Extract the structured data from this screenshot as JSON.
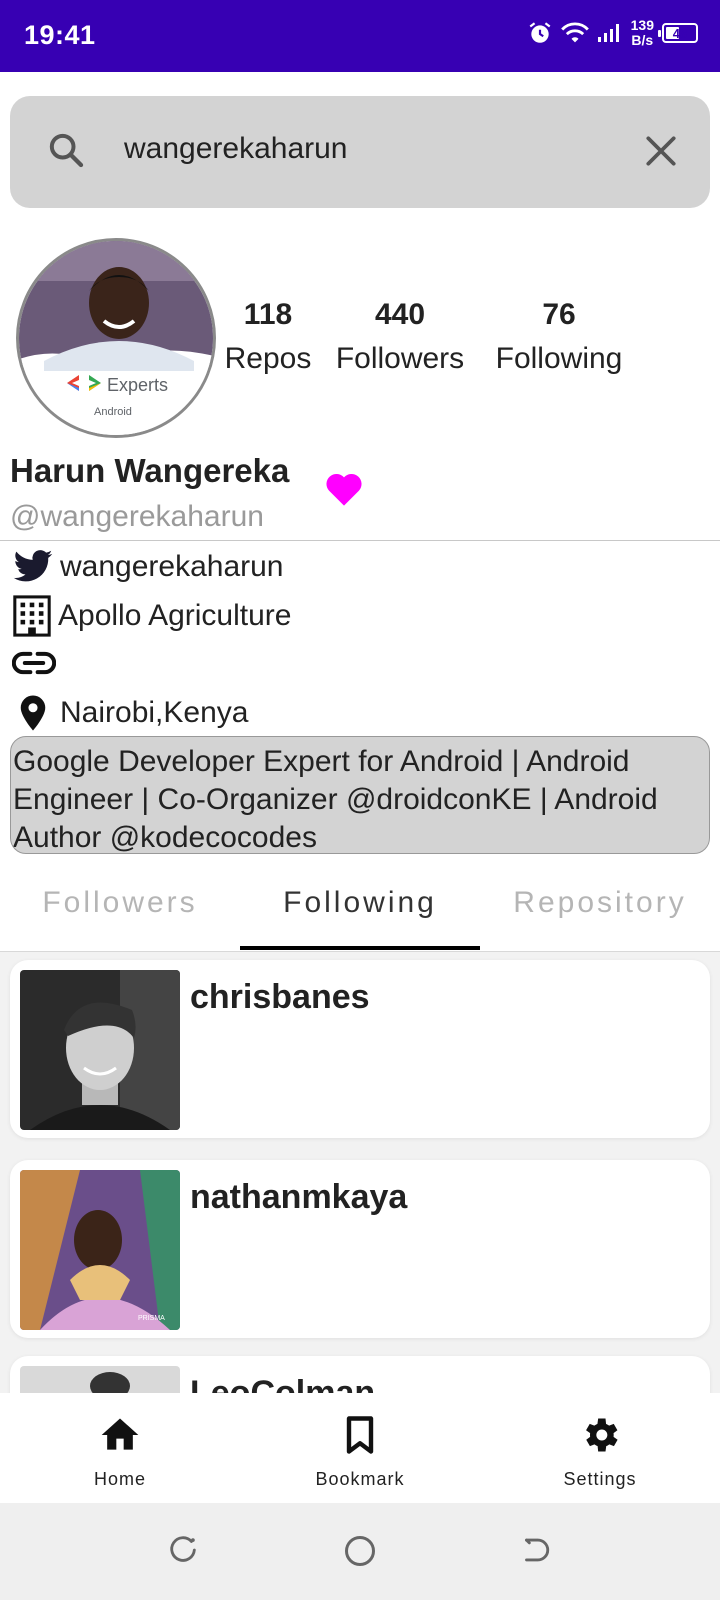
{
  "status_bar": {
    "time": "19:41",
    "net_speed_value": "139",
    "net_speed_unit": "B/s",
    "battery": "48",
    "battery_fraction": 0.48
  },
  "search": {
    "query": "wangerekaharun"
  },
  "profile": {
    "avatar_badge": "Experts",
    "avatar_badge_sub": "Android",
    "stats": {
      "repos": {
        "value": "118",
        "label": "Repos"
      },
      "followers": {
        "value": "440",
        "label": "Followers"
      },
      "following": {
        "value": "76",
        "label": "Following"
      }
    },
    "name": "Harun Wangereka",
    "handle": "@wangerekaharun",
    "twitter": "wangerekaharun",
    "company": "Apollo Agriculture",
    "link": "",
    "location": "Nairobi,Kenya",
    "bio": "Google Developer Expert for Android | Android Engineer | Co-Organizer @droidconKE  | Android Author @kodecocodes"
  },
  "tabs": [
    {
      "label": "Followers",
      "active": false
    },
    {
      "label": "Following",
      "active": true
    },
    {
      "label": "Repository",
      "active": false
    }
  ],
  "following_list": [
    {
      "username": "chrisbanes"
    },
    {
      "username": "nathanmkaya"
    },
    {
      "username": "LeoColman"
    }
  ],
  "bottom_nav": {
    "home": "Home",
    "bookmark": "Bookmark",
    "settings": "Settings"
  },
  "colors": {
    "status_bar": "#3700B3",
    "heart": "#FF00FF",
    "search_bg": "#D3D3D3"
  }
}
